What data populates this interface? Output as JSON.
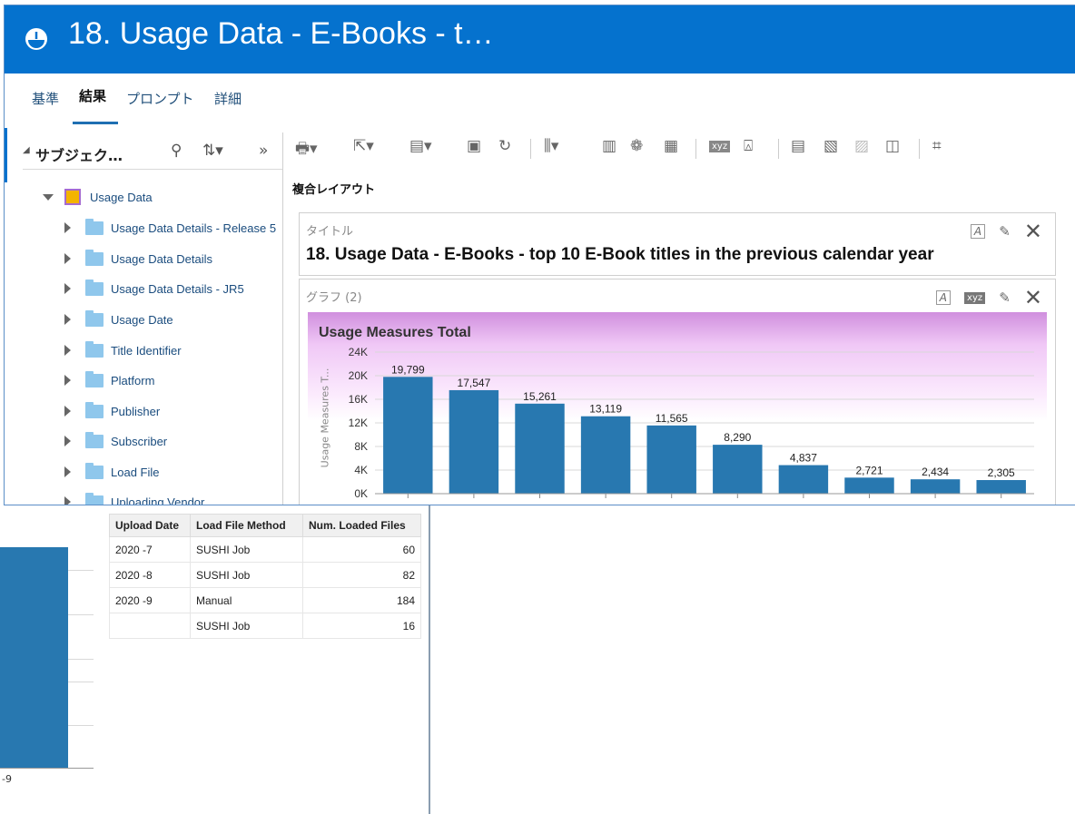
{
  "window": {
    "title": "18. Usage Data - E-Books - t…"
  },
  "tabs": [
    {
      "label": "基準",
      "active": false
    },
    {
      "label": "結果",
      "active": true
    },
    {
      "label": "プロンプト",
      "active": false
    },
    {
      "label": "詳細",
      "active": false
    }
  ],
  "subject_panel": {
    "title": "サブジェク…",
    "root": "Usage Data",
    "items": [
      "Usage Data Details - Release 5",
      "Usage Data Details",
      "Usage Data Details - JR5",
      "Usage Date",
      "Title Identifier",
      "Platform",
      "Publisher",
      "Subscriber",
      "Load File",
      "Uploading Vendor"
    ]
  },
  "compound_layout_label": "複合レイアウト",
  "title_view": {
    "caption": "タイトル",
    "title": "18. Usage Data - E-Books - top 10 E-Book titles in the previous calendar year"
  },
  "graph_view": {
    "caption": "グラフ (2)"
  },
  "chart_data": {
    "type": "bar",
    "title": "Usage Measures Total",
    "ylabel": "Usage Measures T...",
    "xlabel": "",
    "ylim": [
      0,
      24000
    ],
    "yticks": [
      "0K",
      "4K",
      "8K",
      "12K",
      "16K",
      "20K",
      "24K"
    ],
    "values": [
      19799,
      17547,
      15261,
      13119,
      11565,
      8290,
      4837,
      2721,
      2434,
      2305
    ],
    "value_labels": [
      "19,799",
      "17,547",
      "15,261",
      "13,119",
      "11,565",
      "8,290",
      "4,837",
      "2,721",
      "2,434",
      "2,305"
    ],
    "bar_color": "#2878b0"
  },
  "background_table": {
    "headers": [
      "Upload Date",
      "Load File Method",
      "Num. Loaded Files"
    ],
    "rows": [
      [
        "2020 -7",
        "SUSHI Job",
        "60"
      ],
      [
        "2020 -8",
        "SUSHI Job",
        "82"
      ],
      [
        "2020 -9",
        "Manual",
        "184"
      ],
      [
        "",
        "SUSHI Job",
        "16"
      ]
    ]
  },
  "background_chart_axis_label": "-9",
  "colors": {
    "titlebar": "#0572ce",
    "link": "#1a4c7e"
  }
}
